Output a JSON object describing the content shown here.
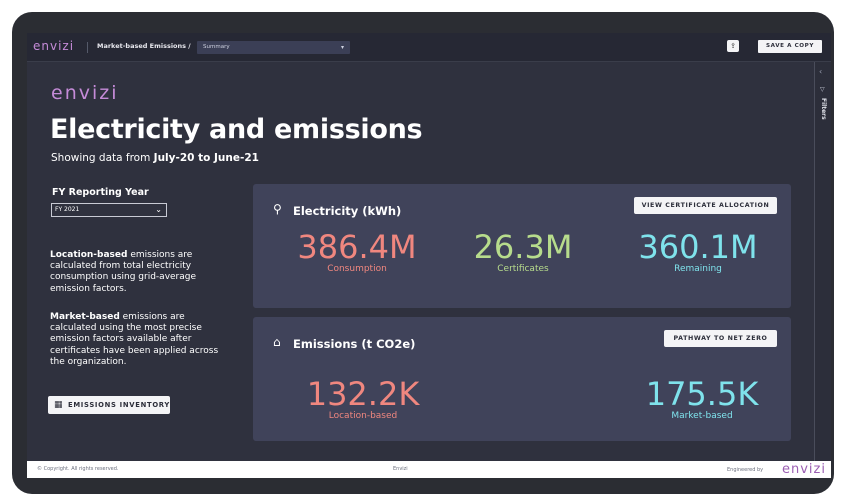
{
  "topbar": {
    "logo": "envizi",
    "breadcrumb": "Market-based Emissions  /",
    "view_select": "Summary",
    "share_icon": "share-icon",
    "save_copy": "SAVE A COPY"
  },
  "right_panel": {
    "filters_label": "Filters"
  },
  "header": {
    "brand": "envizi",
    "title": "Electricity and emissions",
    "subtitle_prefix": "Showing data from ",
    "subtitle_range": "July-20 to June-21"
  },
  "filters": {
    "fy_label": "FY Reporting Year",
    "fy_value": "FY 2021"
  },
  "descriptions": {
    "location_bold": "Location-based",
    "location_text": " emissions are calculated from total electricity consumption using grid-average emission factors.",
    "market_bold": "Market-based",
    "market_text": " emissions are calculated using the most precise emission factors available after certificates have been applied across the organization."
  },
  "inventory_button": "EMISSIONS INVENTORY",
  "electricity_card": {
    "title": "Electricity (kWh)",
    "button": "VIEW CERTIFICATE ALLOCATION",
    "metrics": [
      {
        "value": "386.4M",
        "label": "Consumption",
        "color": "#f0877f"
      },
      {
        "value": "26.3M",
        "label": "Certificates",
        "color": "#b7dc8c"
      },
      {
        "value": "360.1M",
        "label": "Remaining",
        "color": "#7fe3ec"
      }
    ]
  },
  "emissions_card": {
    "title": "Emissions (t CO2e)",
    "button": "PATHWAY TO NET ZERO",
    "metrics": [
      {
        "value": "132.2K",
        "label": "Location-based",
        "color": "#f0877f"
      },
      {
        "value": "175.5K",
        "label": "Market-based",
        "color": "#7fe3ec"
      }
    ]
  },
  "footer": {
    "copyright": "© Copyright. All rights reserved.",
    "center": "Envizi",
    "engineered_by": "Engineered by",
    "logo": "envizi"
  }
}
